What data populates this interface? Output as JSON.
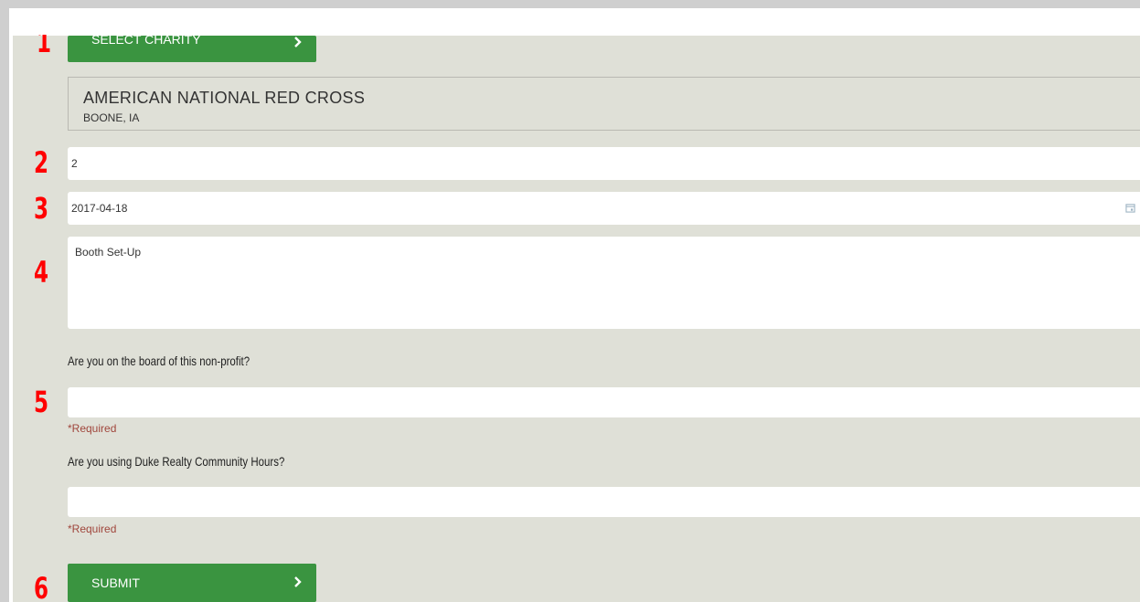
{
  "steps": [
    "1",
    "2",
    "3",
    "4",
    "5",
    "6"
  ],
  "select_charity_button": {
    "label": "SELECT CHARITY"
  },
  "charity": {
    "name": "AMERICAN NATIONAL RED CROSS",
    "location": "BOONE, IA"
  },
  "hours_field": {
    "value": "2"
  },
  "date_field": {
    "value": "2017-04-18",
    "icon": "calendar-icon"
  },
  "description_field": {
    "value": "Booth Set-Up"
  },
  "board_question": {
    "label": "Are you on the board of this non-profit?",
    "value": "",
    "required_text": "*Required"
  },
  "community_hours_question": {
    "label": "Are you using Duke Realty Community Hours?",
    "value": "",
    "required_text": "*Required"
  },
  "submit_button": {
    "label": "SUBMIT"
  },
  "colors": {
    "accent_green": "#3a9440",
    "step_number_red": "#ff0000",
    "form_background": "#dfe0d7",
    "required_text": "#a0463c"
  }
}
